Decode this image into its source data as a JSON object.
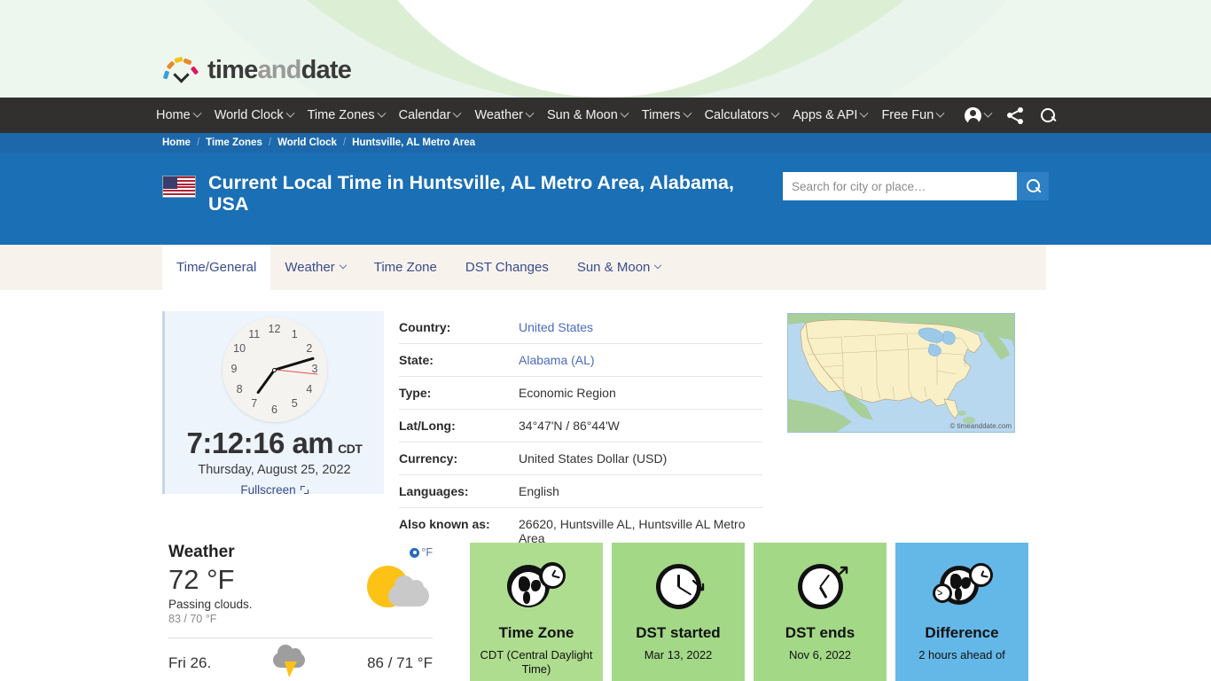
{
  "brand": {
    "part1": "time",
    "part2": "and",
    "part3": "date"
  },
  "nav": {
    "items": [
      {
        "label": "Home",
        "caret": true
      },
      {
        "label": "World Clock",
        "caret": true
      },
      {
        "label": "Time Zones",
        "caret": true
      },
      {
        "label": "Calendar",
        "caret": true
      },
      {
        "label": "Weather",
        "caret": true
      },
      {
        "label": "Sun & Moon",
        "caret": true
      },
      {
        "label": "Timers",
        "caret": true
      },
      {
        "label": "Calculators",
        "caret": true
      },
      {
        "label": "Apps & API",
        "caret": true
      },
      {
        "label": "Free Fun",
        "caret": true
      }
    ],
    "icons": [
      "account-icon",
      "share-icon",
      "search-icon"
    ]
  },
  "breadcrumb": {
    "items": [
      "Home",
      "Time Zones",
      "World Clock",
      "Huntsville, AL Metro Area"
    ],
    "separator": "/"
  },
  "hero": {
    "flag_alt": "usa-flag",
    "title": "Current Local Time in Huntsville, AL Metro Area, Alabama, USA",
    "search_placeholder": "Search for city or place…",
    "search_value": "",
    "search_button": "search-icon",
    "bg_color": "#1a6fb5"
  },
  "tabs": [
    {
      "label": "Time/General",
      "active": true,
      "caret": false
    },
    {
      "label": "Weather",
      "active": false,
      "caret": true
    },
    {
      "label": "Time Zone",
      "active": false,
      "caret": false
    },
    {
      "label": "DST Changes",
      "active": false,
      "caret": false
    },
    {
      "label": "Sun & Moon",
      "active": false,
      "caret": true
    }
  ],
  "clock": {
    "time": "7:12:16 am",
    "timezone_abbr": "CDT",
    "date": "Thursday, August 25, 2022",
    "fullscreen_label": "Fullscreen",
    "hours": 7,
    "minutes": 12,
    "seconds": 16,
    "numerals": [
      "1",
      "2",
      "3",
      "4",
      "5",
      "6",
      "7",
      "8",
      "9",
      "10",
      "11",
      "12"
    ]
  },
  "info": {
    "rows": [
      {
        "label": "Country:",
        "value": "United States",
        "link": true
      },
      {
        "label": "State:",
        "value": "Alabama (AL)",
        "link": true
      },
      {
        "label": "Type:",
        "value": "Economic Region",
        "link": false
      },
      {
        "label": "Lat/Long:",
        "value": "34°47'N / 86°44'W",
        "link": false
      },
      {
        "label": "Currency:",
        "value": "United States Dollar (USD)",
        "link": false
      },
      {
        "label": "Languages:",
        "value": "English",
        "link": false
      },
      {
        "label": "Also known as:",
        "value": "26620, Huntsville AL, Huntsville AL Metro Area",
        "link": false
      }
    ]
  },
  "map": {
    "credit": "© timeanddate.com"
  },
  "weather": {
    "title": "Weather",
    "unit_toggle": "°F",
    "temperature": "72 °F",
    "description": "Passing clouds.",
    "hilo": "83 / 70 °F",
    "icon": "sun-behind-cloud-icon",
    "forecast": [
      {
        "day": "Fri 26.",
        "icon": "thunderstorm-icon",
        "hilo": "86 / 71 °F"
      }
    ]
  },
  "cards": [
    {
      "icon": "globe-clock-icon",
      "title": "Time Zone",
      "sub": "CDT (Central Daylight Time)",
      "color": "#aedd8f"
    },
    {
      "icon": "clock-arrow-down-icon",
      "title": "DST started",
      "sub": "Mar 13, 2022",
      "color": "#a3d887"
    },
    {
      "icon": "clock-arrow-up-icon",
      "title": "DST ends",
      "sub": "Nov 6, 2022",
      "color": "#a3d887"
    },
    {
      "icon": "world-clocks-icon",
      "title": "Difference",
      "sub": "2 hours ahead of",
      "color": "#64b8e8"
    }
  ]
}
